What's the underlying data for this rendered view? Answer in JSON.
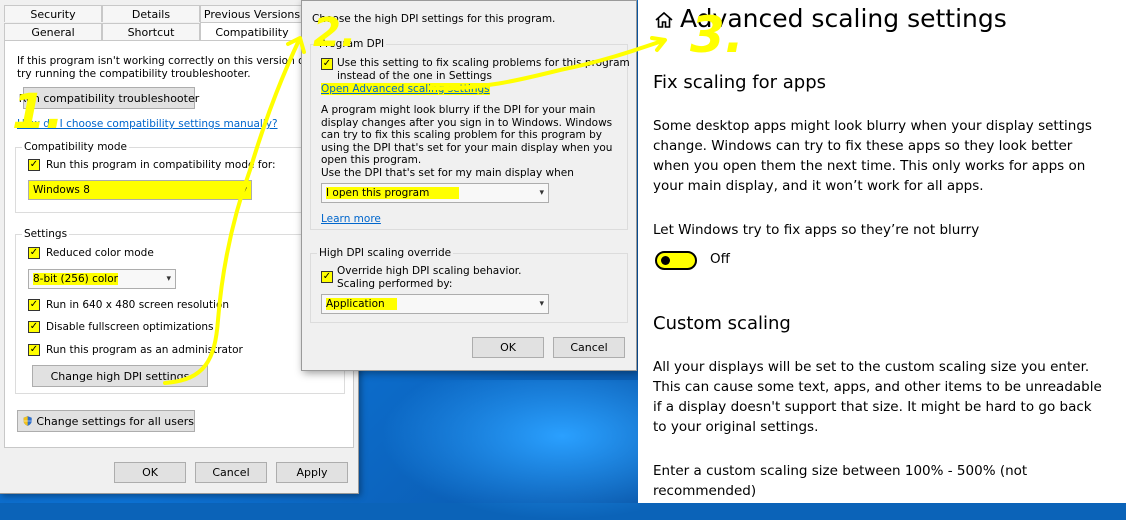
{
  "props_dialog": {
    "tabs_row1": [
      "Security",
      "Details",
      "Previous Versions"
    ],
    "tabs_row2": [
      "General",
      "Shortcut",
      "Compatibility"
    ],
    "intro_line1": "If this program isn't working correctly on this version of Windows,",
    "intro_line2": "try running the compatibility troubleshooter.",
    "troubleshooter_button": "Run compatibility troubleshooter",
    "manual_link": "How do I choose compatibility settings manually?",
    "compat_mode_group": "Compatibility mode",
    "compat_mode_checkbox": "Run this program in compatibility mode for:",
    "compat_mode_value": "Windows 8",
    "settings_group": "Settings",
    "reduced_color": "Reduced color mode",
    "color_value": "8-bit (256) color",
    "resolution_640": "Run in 640 x 480 screen resolution",
    "disable_fullscreen": "Disable fullscreen optimizations",
    "run_as_admin": "Run this program as an administrator",
    "change_dpi_button": "Change high DPI settings",
    "change_all_users_button": "Change settings for all users",
    "ok": "OK",
    "cancel": "Cancel",
    "apply": "Apply"
  },
  "dpi_dialog": {
    "heading": "Choose the high DPI settings for this program.",
    "program_dpi_group": "Program DPI",
    "use_setting_line1": "Use this setting to fix scaling problems for this program",
    "use_setting_line2": "instead of the one in Settings",
    "advanced_link": "Open Advanced scaling settings",
    "blurry_text": "A program might look blurry if the DPI for your main display changes after you sign in to Windows. Windows can try to fix this scaling problem for this program by using the DPI that's set for your main display when you open this program.",
    "use_dpi_label": "Use the DPI that's set for my main display when",
    "use_dpi_value": "I open this program",
    "learn_more": "Learn more",
    "override_group": "High DPI scaling override",
    "override_line1": "Override high DPI scaling behavior.",
    "override_line2": "Scaling performed by:",
    "override_value": "Application",
    "ok": "OK",
    "cancel": "Cancel"
  },
  "settings_panel": {
    "title": "Advanced scaling settings",
    "fix_heading": "Fix scaling for apps",
    "fix_text": "Some desktop apps might look blurry when your display settings change. Windows can try to fix these apps so they look better when you open them the next time. This only works for apps on your main display, and it won’t work for all apps.",
    "let_windows": "Let Windows try to fix apps so they’re not blurry",
    "toggle_state": "Off",
    "custom_heading": "Custom scaling",
    "custom_text": "All your displays will be set to the custom scaling size you enter. This can cause some text, apps, and other items to be unreadable if a display doesn't support that size. It might be hard to go back to your original settings.",
    "enter_text": "Enter a custom scaling size between 100% - 500% (not recommended)"
  },
  "annotations": {
    "step1": "1.",
    "step2": "2.",
    "step3": "3.",
    "marker_color": "#ffff00"
  },
  "icons": [
    "checkmark-icon",
    "dropdown-arrow-icon",
    "shield-icon",
    "home-icon"
  ]
}
